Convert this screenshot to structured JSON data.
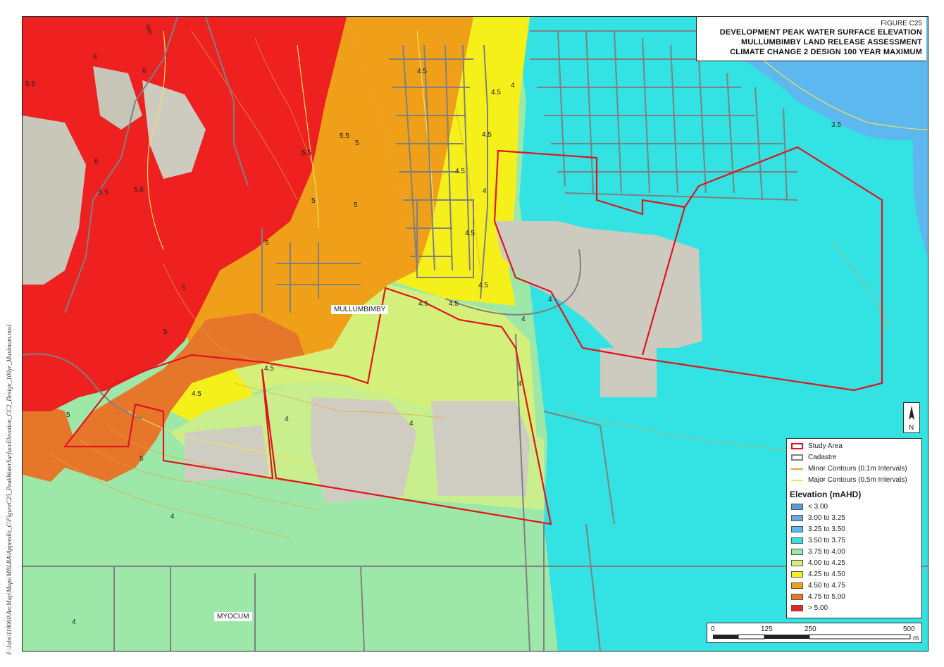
{
  "figure": {
    "number": "FIGURE C25",
    "title_lines": [
      "DEVELOPMENT PEAK WATER SURFACE ELEVATION",
      "MULLUMBIMBY LAND RELEASE ASSESSMENT",
      "CLIMATE CHANGE 2 DESIGN 100 YEAR MAXIMUM"
    ]
  },
  "places": {
    "mullumbimby": "MULLUMBIMBY",
    "myocum": "MYOCUM"
  },
  "contour_labels": [
    "6",
    "6",
    "5.5",
    "6",
    "5",
    "5.5",
    "5.5",
    "6",
    "5.5",
    "5.5",
    "5",
    "5",
    "5",
    "5",
    "5",
    "5",
    "4.5",
    "4.5",
    "4.5",
    "4",
    "4.5",
    "4.5",
    "4.5",
    "4.5",
    "4",
    "4.5",
    "4",
    "4",
    "4",
    "4",
    "3.5",
    "4.5",
    "4",
    "4.5",
    "5",
    "4",
    "4",
    "4",
    "5"
  ],
  "legend": {
    "items": [
      {
        "label": "Study Area",
        "kind": "outline",
        "color": "#e0141e"
      },
      {
        "label": "Cadastre",
        "kind": "outline",
        "color": "#808080"
      },
      {
        "label": "Minor Contours (0.1m Intervals)",
        "kind": "line",
        "color": "#e8a040"
      },
      {
        "label": "Major Contours (0.5m Intervals)",
        "kind": "line",
        "color": "#f2e060"
      }
    ],
    "elevation_heading": "Elevation (mAHD)",
    "classes": [
      {
        "label": "< 3.00",
        "color": "#5a9ad6"
      },
      {
        "label": "3.00 to 3.25",
        "color": "#6aa8e0"
      },
      {
        "label": "3.25 to 3.50",
        "color": "#5cb8ee"
      },
      {
        "label": "3.50 to 3.75",
        "color": "#33e2e2"
      },
      {
        "label": "3.75 to 4.00",
        "color": "#9de8a8"
      },
      {
        "label": "4.00 to 4.25",
        "color": "#d5f07a"
      },
      {
        "label": "4.25 to 4.50",
        "color": "#f6f01a"
      },
      {
        "label": "4.50 to 4.75",
        "color": "#f0a018"
      },
      {
        "label": "4.75 to 5.00",
        "color": "#e6762a"
      },
      {
        "label": "> 5.00",
        "color": "#ee2020"
      }
    ]
  },
  "scale": {
    "ticks": [
      "0",
      "125",
      "250",
      "500"
    ],
    "unit": "m"
  },
  "north_label": "N",
  "file_path": "J:\\Jobs\\119060\\ArcMap\\Maps\\MBLRA\\Appendix_C\\FigureC25_PeakWaterSurfaceElevation_CC2_Design_100yr_Maximum.mxd"
}
